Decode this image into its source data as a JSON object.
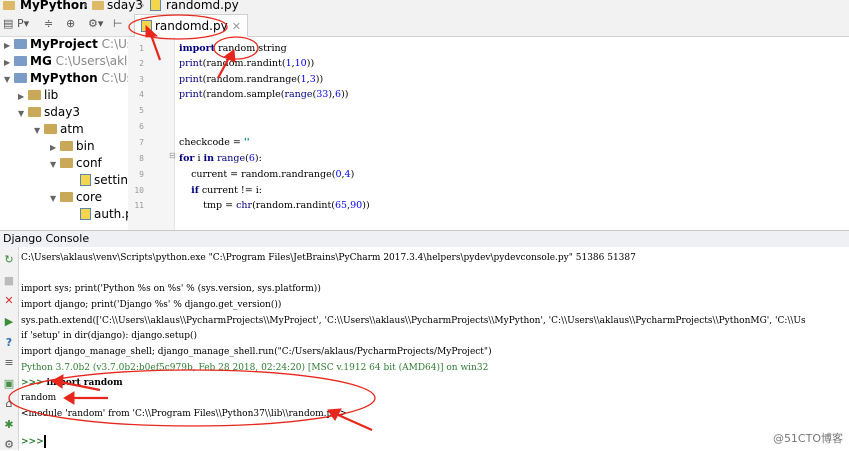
{
  "breadcrumb": {
    "project": "MyPython",
    "folder": "sday3",
    "file": "randomd.py"
  },
  "tree": {
    "nodes": [
      {
        "label": "MyProject",
        "path": "C:\\Users"
      },
      {
        "label": "MG",
        "path": "C:\\Users\\aklaus"
      },
      {
        "label": "MyPython",
        "path": "C:\\Users"
      },
      {
        "label": "lib",
        "path": ""
      },
      {
        "label": "sday3",
        "path": ""
      },
      {
        "label": "atm",
        "path": ""
      },
      {
        "label": "bin",
        "path": ""
      },
      {
        "label": "conf",
        "path": ""
      },
      {
        "label": "settings",
        "path": ""
      },
      {
        "label": "core",
        "path": ""
      },
      {
        "label": "auth.py",
        "path": ""
      }
    ]
  },
  "editor": {
    "tab_label": "randomd.py",
    "line_numbers": [
      "1",
      "2",
      "3",
      "4",
      "5",
      "6",
      "7",
      "8",
      "9",
      "10",
      "11"
    ]
  },
  "console": {
    "title": "Django Console",
    "lines": [
      "C:\\Users\\aklaus\\venv\\Scripts\\python.exe \"C:\\Program Files\\JetBrains\\PyCharm 2017.3.4\\helpers\\pydev\\pydevconsole.py\" 51386 51387",
      "import sys; print('Python %s on %s' % (sys.version, sys.platform))",
      "import django; print('Django %s' % django.get_version())",
      "sys.path.extend(['C:\\\\Users\\\\aklaus\\\\PycharmProjects\\\\MyProject', 'C:\\\\Users\\\\aklaus\\\\PycharmProjects\\\\MyPython', 'C:\\\\Users\\\\aklaus\\\\PycharmProjects\\\\PythonMG', 'C:\\\\Us",
      "if 'setup' in dir(django): django.setup()",
      "import django_manage_shell; django_manage_shell.run(\"C:/Users/aklaus/PycharmProjects/MyProject\")",
      "Python 3.7.0b2 (v3.7.0b2:b0ef5c979b, Feb 28 2018, 02:24:20) [MSC v.1912 64 bit (AMD64)] on win32",
      "import random",
      "random",
      "<module 'random' from 'C:\\\\Program Files\\\\Python37\\\\lib\\\\random.py'>"
    ],
    "prompt": ">>>"
  },
  "watermark": "@51CTO博客",
  "colors": {
    "annotation": "#e8261c",
    "keyword": "#000080",
    "number": "#0000ff",
    "string": "#008080"
  }
}
